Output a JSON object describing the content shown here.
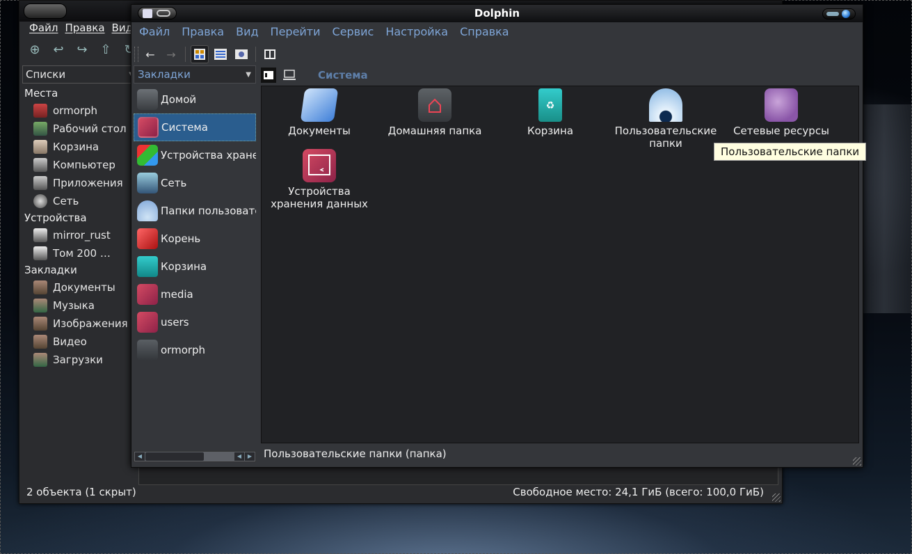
{
  "window": {
    "title": "Dolphin"
  },
  "menu": [
    "Файл",
    "Правка",
    "Вид",
    "Перейти",
    "Сервис",
    "Настройка",
    "Справка"
  ],
  "sidebar": {
    "combo": "Закладки",
    "items": [
      {
        "label": "Домой",
        "icon": "home-folder-icon"
      },
      {
        "label": "Система",
        "icon": "system-icon",
        "selected": true
      },
      {
        "label": "Устройства хранения данных",
        "icon": "storage-cubes-icon"
      },
      {
        "label": "Сеть",
        "icon": "network-icon"
      },
      {
        "label": "Папки пользователей",
        "icon": "igloo-icon"
      },
      {
        "label": "Корень",
        "icon": "red-folder-icon"
      },
      {
        "label": "Корзина",
        "icon": "trash-icon"
      },
      {
        "label": "media",
        "icon": "system-icon"
      },
      {
        "label": "users",
        "icon": "system-icon"
      },
      {
        "label": "ormorph",
        "icon": "dark-folder-icon"
      }
    ]
  },
  "breadcrumb": {
    "location": "Система"
  },
  "files": [
    {
      "label": "Документы",
      "icon": "documents-folder-icon"
    },
    {
      "label": "Домашняя папка",
      "icon": "home-folder-icon"
    },
    {
      "label": "Корзина",
      "icon": "trash-icon"
    },
    {
      "label": "Пользовательские папки",
      "icon": "igloo-icon"
    },
    {
      "label": "Сетевые ресурсы",
      "icon": "globe-icon"
    },
    {
      "label": "Устройства хранения данных",
      "icon": "system-icon"
    }
  ],
  "tooltip": "Пользовательские папки",
  "status": "Пользовательские папки (папка)",
  "back_window": {
    "menu": [
      "Файл",
      "Правка",
      "Вид"
    ],
    "combo": "Списки",
    "places_header": "Места",
    "places": [
      "ormorph",
      "Рабочий стол",
      "Корзина",
      "Компьютер",
      "Приложения",
      "Сеть"
    ],
    "devices_header": "Устройства",
    "devices": [
      "mirror_rust",
      "Том 200 …"
    ],
    "bookmarks_header": "Закладки",
    "bookmarks": [
      "Документы",
      "Музыка",
      "Изображения",
      "Видео",
      "Загрузки"
    ],
    "status_left": "2 объекта (1 скрыт)",
    "status_right": "Свободное место: 24,1 ГиБ (всего: 100,0 ГиБ)"
  },
  "colors": {
    "accent": "#2a5d8e",
    "menu": "#7fa6d8",
    "system_icon": "#c03a57",
    "trash": "#2ab3a6"
  }
}
